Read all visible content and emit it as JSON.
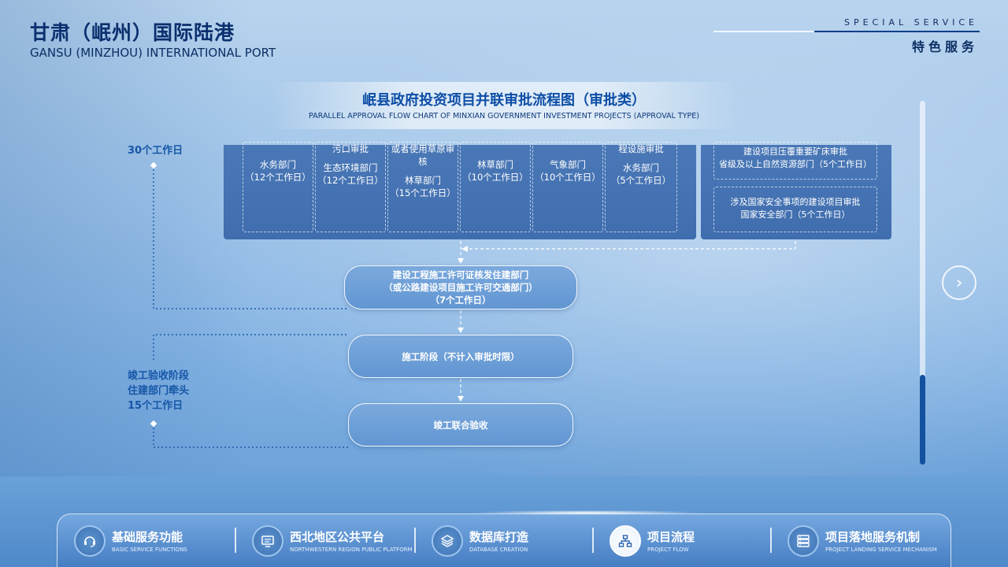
{
  "header": {
    "title_cn": "甘肃（岷州）国际陆港",
    "title_en": "GANSU (MINZHOU) INTERNATIONAL PORT",
    "special_en": "SPECIAL SERVICE",
    "special_cn": "特色服务"
  },
  "chart": {
    "title": "岷县政府投资项目并联审批流程图（审批类）",
    "subtitle": "PARALLEL APPROVAL FLOW CHART OF MINXIAN GOVERNMENT INVESTMENT PROJECTS (APPROVAL TYPE)"
  },
  "left_labels": {
    "top": "30个工作日",
    "bottom_1": "竣工验收阶段",
    "bottom_2": "住建部门牵头",
    "bottom_3": "15个工作日"
  },
  "panel_left_cells": [
    {
      "a": "",
      "b": "水务部门",
      "c": "（12个工作日）"
    },
    {
      "a": "污口审批",
      "b": "生态环境部门",
      "c": "（12个工作日）"
    },
    {
      "a": "或者使用草原审",
      "a2": "核",
      "b": "林草部门",
      "c": "（15个工作日）"
    },
    {
      "a": "",
      "b": "林草部门",
      "c": "（10个工作日）"
    },
    {
      "a": "",
      "b": "气象部门",
      "c": "（10个工作日）"
    },
    {
      "a": "程设施审批",
      "b": "水务部门",
      "c": "（5个工作日）"
    }
  ],
  "panel_right_cells": [
    {
      "a": "建设项目压覆重要矿床审批",
      "b": "省级及以上自然资源部门（5个工作日）"
    },
    {
      "a": "涉及国家安全事项的建设项目审批",
      "b": "国家安全部门（5个工作日）"
    }
  ],
  "flow": {
    "step1_l1": "建设工程施工许可证核发住建部门",
    "step1_l2": "（或公路建设项目施工许可交通部门）",
    "step1_l3": "（7个工作日）",
    "step2": "施工阶段（不计入审批时限）",
    "step3": "竣工联合验收"
  },
  "nav": [
    {
      "label": "基础服务功能",
      "sub": "BASIC SERVICE FUNCTIONS",
      "icon": "headset-icon"
    },
    {
      "label": "西北地区公共平台",
      "sub": "NORTHWESTERN REGION PUBLIC PLATFORM",
      "icon": "monitor-icon"
    },
    {
      "label": "数据库打造",
      "sub": "DATABASE CREATION",
      "icon": "layers-icon"
    },
    {
      "label": "项目流程",
      "sub": "PROJECT FLOW",
      "icon": "hierarchy-icon",
      "active": true
    },
    {
      "label": "项目落地服务机制",
      "sub": "PROJECT LANDING SERVICE MECHANISM",
      "icon": "server-icon"
    }
  ],
  "colors": {
    "accent": "#0d4ea6",
    "panel": "#4374b3",
    "scroll_thumb": "#14519f"
  }
}
